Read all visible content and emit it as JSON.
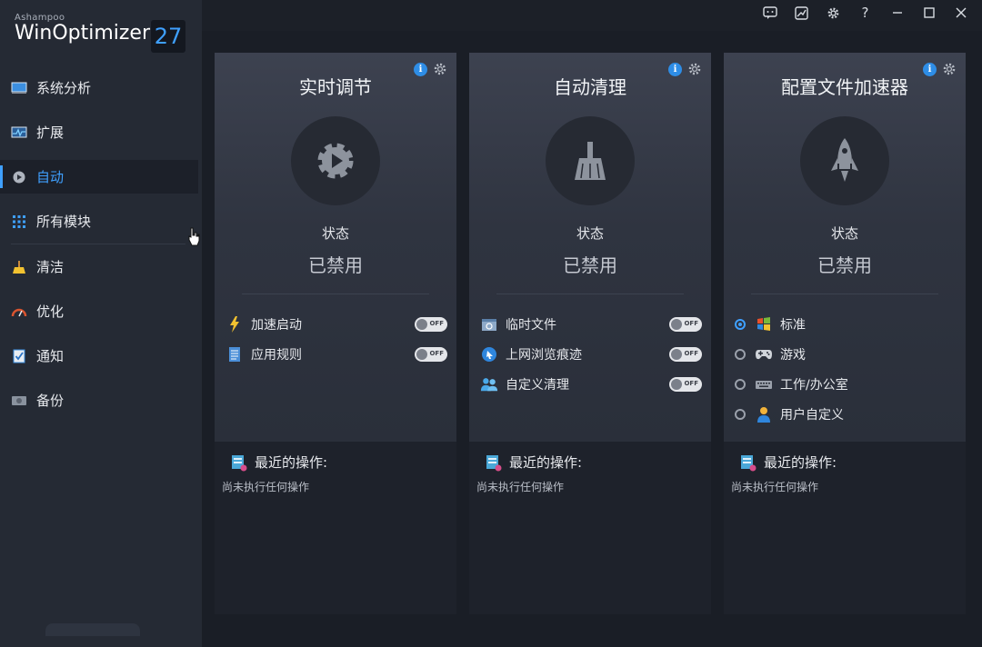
{
  "app": {
    "brand": "Ashampoo",
    "product": "WinOptimizer",
    "version": "27"
  },
  "titlebar": {
    "icons": [
      "feedback-icon",
      "chart-icon",
      "gear-icon",
      "help-icon",
      "minimize-icon",
      "maximize-icon",
      "close-icon"
    ],
    "help_label": "?"
  },
  "sidebar": {
    "items": [
      {
        "label": "系统分析",
        "icon": "monitor-icon",
        "active": false
      },
      {
        "label": "扩展",
        "icon": "pulse-monitor-icon",
        "active": false
      },
      {
        "label": "自动",
        "icon": "auto-play-icon",
        "active": true
      },
      {
        "label": "所有模块",
        "icon": "grid-icon",
        "active": false
      },
      {
        "label": "清洁",
        "icon": "broom-icon",
        "active": false
      },
      {
        "label": "优化",
        "icon": "speedometer-icon",
        "active": false
      },
      {
        "label": "通知",
        "icon": "checklist-icon",
        "active": false
      },
      {
        "label": "备份",
        "icon": "backup-drive-icon",
        "active": false
      }
    ]
  },
  "cards": [
    {
      "title": "实时调节",
      "hero_icon": "gear-play-icon",
      "status_label": "状态",
      "status_value": "已禁用",
      "options": [
        {
          "label": "加速启动",
          "icon": "lightning-icon",
          "toggle": "OFF"
        },
        {
          "label": "应用规则",
          "icon": "rules-list-icon",
          "toggle": "OFF"
        }
      ],
      "recent_label": "最近的操作:",
      "recent_text": "尚未执行任何操作"
    },
    {
      "title": "自动清理",
      "hero_icon": "broom-icon",
      "status_label": "状态",
      "status_value": "已禁用",
      "options": [
        {
          "label": "临时文件",
          "icon": "temp-files-icon",
          "toggle": "OFF"
        },
        {
          "label": "上网浏览痕迹",
          "icon": "browser-traces-icon",
          "toggle": "OFF"
        },
        {
          "label": "自定义清理",
          "icon": "users-icon",
          "toggle": "OFF"
        }
      ],
      "recent_label": "最近的操作:",
      "recent_text": "尚未执行任何操作"
    },
    {
      "title": "配置文件加速器",
      "hero_icon": "rocket-icon",
      "status_label": "状态",
      "status_value": "已禁用",
      "radios": [
        {
          "label": "标准",
          "icon": "windows-logo-icon",
          "checked": true
        },
        {
          "label": "游戏",
          "icon": "gamepad-icon",
          "checked": false
        },
        {
          "label": "工作/办公室",
          "icon": "keyboard-icon",
          "checked": false
        },
        {
          "label": "用户自定义",
          "icon": "user-icon",
          "checked": false
        }
      ],
      "recent_label": "最近的操作:",
      "recent_text": "尚未执行任何操作"
    }
  ],
  "colors": {
    "accent": "#3fa0ff",
    "sidebar_bg": "#252a34",
    "card_gradient_top": "#3d4250"
  }
}
